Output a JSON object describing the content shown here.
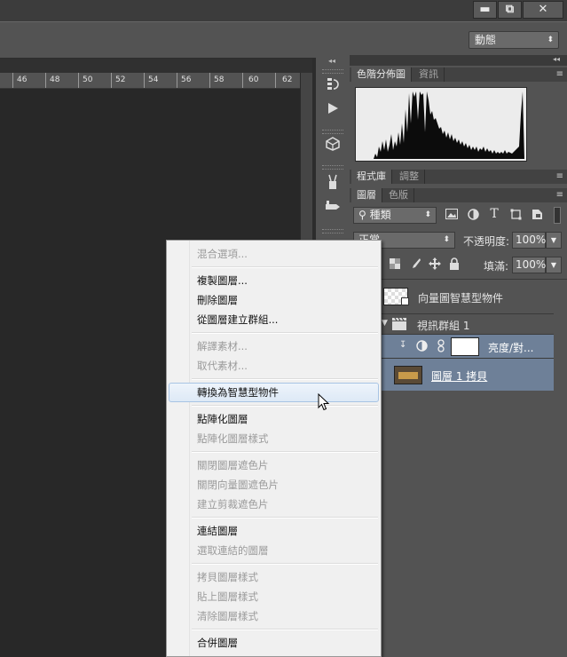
{
  "window": {
    "minimize": "▬",
    "restore": "⧉",
    "close": "✕"
  },
  "options_bar": {
    "workspace": "動態",
    "workspace_arrow": "⬍"
  },
  "ruler": {
    "ticks": [
      "46",
      "48",
      "50",
      "52",
      "54",
      "56",
      "58",
      "60",
      "62"
    ]
  },
  "panels": {
    "collapse_glyph": "◂◂",
    "menu_glyph": "≡",
    "group1_tabs": [
      "色階分佈圖",
      "資訊"
    ],
    "group2_tabs": [
      "程式庫",
      "調整"
    ],
    "group3_tabs": [
      "圖層",
      "色版"
    ],
    "filter_kind": "⚲ 種類",
    "blend_mode": "正常",
    "opacity_label": "不透明度:",
    "opacity_value": "100%",
    "fill_label": "填滿:",
    "fill_value": "100%",
    "layers": [
      {
        "name": "向量圖智慧型物件"
      },
      {
        "name": "視訊群組 1"
      },
      {
        "name": "亮度/對..."
      },
      {
        "name": "圖層 1 拷貝"
      }
    ]
  },
  "context_menu": {
    "items": [
      {
        "label": "混合選項...",
        "enabled": false
      },
      {
        "label": "複製圖層...",
        "enabled": true
      },
      {
        "label": "刪除圖層",
        "enabled": true
      },
      {
        "label": "從圖層建立群組...",
        "enabled": true
      },
      {
        "label": "解譯素材...",
        "enabled": false
      },
      {
        "label": "取代素材...",
        "enabled": false
      },
      {
        "label": "轉換為智慧型物件",
        "enabled": true,
        "highlighted": true
      },
      {
        "label": "點陣化圖層",
        "enabled": true
      },
      {
        "label": "點陣化圖層樣式",
        "enabled": false
      },
      {
        "label": "關閉圖層遮色片",
        "enabled": false
      },
      {
        "label": "關閉向量圖遮色片",
        "enabled": false
      },
      {
        "label": "建立剪裁遮色片",
        "enabled": false
      },
      {
        "label": "連結圖層",
        "enabled": true
      },
      {
        "label": "選取連結的圖層",
        "enabled": false
      },
      {
        "label": "拷貝圖層樣式",
        "enabled": false
      },
      {
        "label": "貼上圖層樣式",
        "enabled": false
      },
      {
        "label": "清除圖層樣式",
        "enabled": false
      },
      {
        "label": "合併圖層",
        "enabled": true
      }
    ]
  },
  "colors": {
    "menu_bg": "#f0f0f0",
    "highlight_border": "#a8c4e4",
    "selected_layer": "#6e8098",
    "panel_bg": "#535353"
  }
}
